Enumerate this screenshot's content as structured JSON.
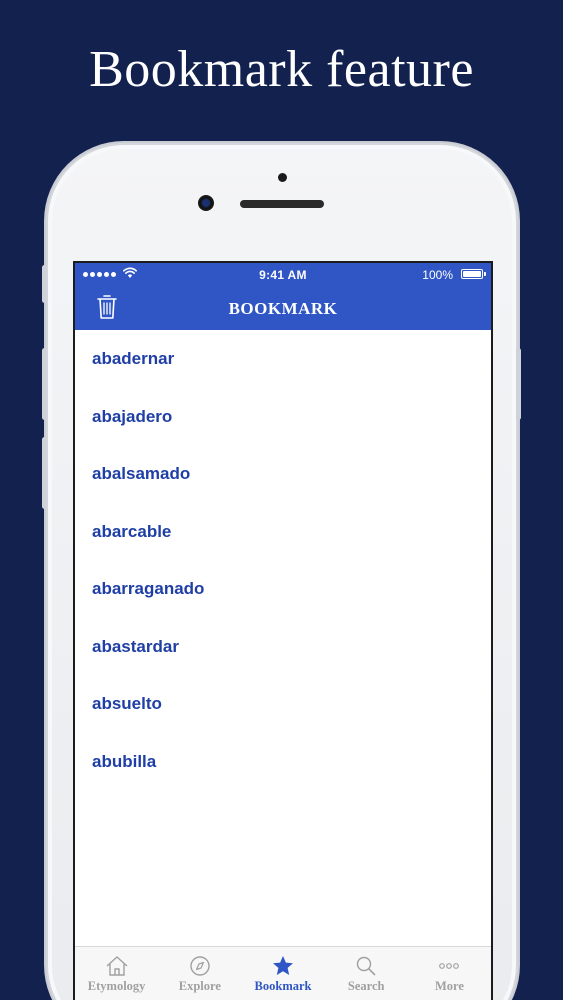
{
  "promo": {
    "title": "Bookmark feature"
  },
  "statusbar": {
    "time": "9:41 AM",
    "battery": "100%",
    "battery_level": 1.0
  },
  "navbar": {
    "title": "BOOKMARK",
    "trash_icon": "trash-icon"
  },
  "bookmarks": [
    "abadernar",
    "abajadero",
    "abalsamado",
    "abarcable",
    "abarraganado",
    "abastardar",
    "absuelto",
    "abubilla"
  ],
  "tabs": [
    {
      "label": "Etymology",
      "icon": "house-icon",
      "active": false
    },
    {
      "label": "Explore",
      "icon": "compass-icon",
      "active": false
    },
    {
      "label": "Bookmark",
      "icon": "star-icon",
      "active": true
    },
    {
      "label": "Search",
      "icon": "search-icon",
      "active": false
    },
    {
      "label": "More",
      "icon": "more-icon",
      "active": false
    }
  ],
  "colors": {
    "background": "#13214f",
    "accent": "#2f56c4",
    "list_text": "#1f3fa6",
    "inactive_tab": "#a0a0a0"
  }
}
